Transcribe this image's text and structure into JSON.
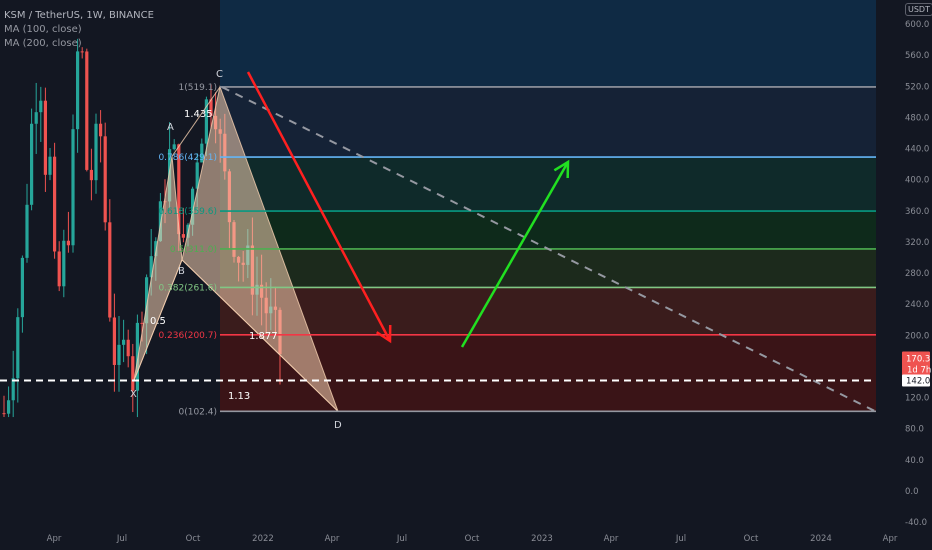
{
  "legend": {
    "symbol": "KSM / TetherUS, 1W, BINANCE",
    "ma1": "MA (100, close)",
    "ma2": "MA (200, close)"
  },
  "currency": "USDT",
  "price_tag": {
    "value": "170.3",
    "countdown": "1d 7h"
  },
  "level_tag": "142.0",
  "colors": {
    "background": "#131722",
    "bull": "#26a69a",
    "bear": "#ef5350",
    "pattern_fill": "#f5d0b0",
    "down_arrow": "#ff2020",
    "up_arrow": "#21e021"
  },
  "chart_data": {
    "type": "candlestick",
    "ylim": [
      -40,
      620
    ],
    "y_ticks": [
      "600.0",
      "560.0",
      "520.0",
      "480.0",
      "440.0",
      "400.0",
      "360.0",
      "320.0",
      "280.0",
      "240.0",
      "200.0",
      "160.0",
      "120.0",
      "80.0",
      "40.0",
      "0.0",
      "-40.0"
    ],
    "x_ticks": [
      "Apr",
      "Jul",
      "Oct",
      "2022",
      "Apr",
      "Jul",
      "Oct",
      "2023",
      "Apr",
      "Jul",
      "Oct",
      "2024",
      "Apr"
    ],
    "candle_range": {
      "low": 95,
      "high": 625
    },
    "fib_levels": [
      {
        "ratio": "1",
        "price": 519.1,
        "label": "1(519.1)",
        "line": "#9598a1",
        "fill": "#1f1f23"
      },
      {
        "ratio": "0.786",
        "price": 429.1,
        "label": "0.786(429.1)",
        "line": "#64b5f6",
        "fill": "#152236"
      },
      {
        "ratio": "0.618",
        "price": 359.6,
        "label": "0.618(359.6)",
        "line": "#089981",
        "fill": "#0f2a2a"
      },
      {
        "ratio": "0.5",
        "price": 311,
        "label": "0.5(311.0)",
        "line": "#4caf50",
        "fill": "#0e2a1b"
      },
      {
        "ratio": "0.382",
        "price": 261.6,
        "label": "0.382(261.6)",
        "line": "#81c784",
        "fill": "#1c2a1c"
      },
      {
        "ratio": "0.236",
        "price": 200.7,
        "label": "0.236(200.7)",
        "line": "#f23645",
        "fill": "#3a1c1c"
      },
      {
        "ratio": "0",
        "price": 102.4,
        "label": "0(102.4)",
        "line": "#9598a1",
        "fill": "#3a1417"
      }
    ],
    "top_zone_color": "#0f2a44",
    "pattern": {
      "X": {
        "label": "X",
        "price": 142
      },
      "A": {
        "label": "A",
        "price": 430
      },
      "B": {
        "label": "B",
        "price": 297
      },
      "C": {
        "label": "C",
        "price": 519.1
      },
      "D": {
        "label": "D",
        "price": 102.4
      },
      "ratios": [
        "0.5",
        "1.435",
        "1.877",
        "1.13"
      ]
    },
    "dashed_level": 142.0
  }
}
